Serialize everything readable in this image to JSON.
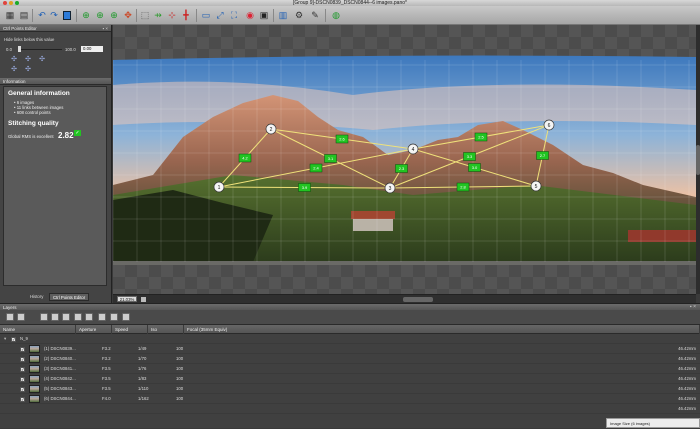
{
  "window": {
    "title": "[Group 9]-DSCN0839_DSCN0844--6 images.pano*"
  },
  "toolbar": {
    "icons": [
      "grid-icon",
      "undo-icon",
      "redo-icon",
      "blue-square-icon",
      "crosshair-icon",
      "crosshair-add-icon",
      "crosshair-link-icon",
      "crosshair-move-icon",
      "select-rect-icon",
      "align-icon",
      "horizon-icon",
      "stitch-icon",
      "panorama-icon",
      "transform-icon",
      "projection-icon",
      "color-icon",
      "image-icon",
      "render-icon",
      "settings-icon",
      "tools-icon",
      "help-icon"
    ]
  },
  "cp_editor": {
    "title": "Ctrl Points Editor",
    "hide_label": "Hide links below this value",
    "slider_min": "0.0",
    "slider_max": "100.0",
    "slider_value": "0.00"
  },
  "info": {
    "title": "Information",
    "general_title": "General information",
    "bullets": [
      "6 images",
      "11 links between images",
      "608 control points"
    ],
    "stitch_title": "Stitching quality",
    "rms_label": "Global RMS is excellent",
    "rms_value": "2.82"
  },
  "left_tabs": [
    "History",
    "Ctrl Points Editor"
  ],
  "view": {
    "zoom": "21.03%"
  },
  "layers": {
    "title": "Layers",
    "columns": [
      "Name",
      "Aperture",
      "Speed",
      "Iso",
      "Focal (35mm Equiv)"
    ],
    "group": "N_9",
    "rows": [
      {
        "name": "(1) DSCN0839...",
        "aperture": "F3.2",
        "speed": "1/49",
        "iso": "100",
        "focal": "46.42mm"
      },
      {
        "name": "(2) DSCN0840...",
        "aperture": "F3.2",
        "speed": "1/70",
        "iso": "100",
        "focal": "46.42mm"
      },
      {
        "name": "(3) DSCN0841...",
        "aperture": "F3.5",
        "speed": "1/76",
        "iso": "100",
        "focal": "46.42mm"
      },
      {
        "name": "(4) DSCN0842...",
        "aperture": "F3.5",
        "speed": "1/83",
        "iso": "100",
        "focal": "46.42mm"
      },
      {
        "name": "(5) DSCN0843...",
        "aperture": "F3.5",
        "speed": "1/110",
        "iso": "100",
        "focal": "46.42mm"
      },
      {
        "name": "(6) DSCN0844...",
        "aperture": "F4.0",
        "speed": "1/162",
        "iso": "100",
        "focal": "46.42mm"
      }
    ],
    "extra_focal": "46.42mm"
  },
  "graph": {
    "nodes": [
      {
        "label": "1"
      },
      {
        "label": "2"
      },
      {
        "label": "3"
      },
      {
        "label": "4"
      },
      {
        "label": "5"
      },
      {
        "label": "6"
      }
    ],
    "link_badges": [
      "4.2",
      "3.9",
      "3.1",
      "2.6",
      "2.3",
      "2.8",
      "3.0",
      "2.5",
      "2.7",
      "2.4",
      "3.3"
    ]
  },
  "status": {
    "text": "Image Size (6 images)"
  },
  "colors": {
    "panel": "#444444",
    "link": "#f0e27a",
    "badge": "#22c422",
    "accent": "#2d7bd8"
  }
}
